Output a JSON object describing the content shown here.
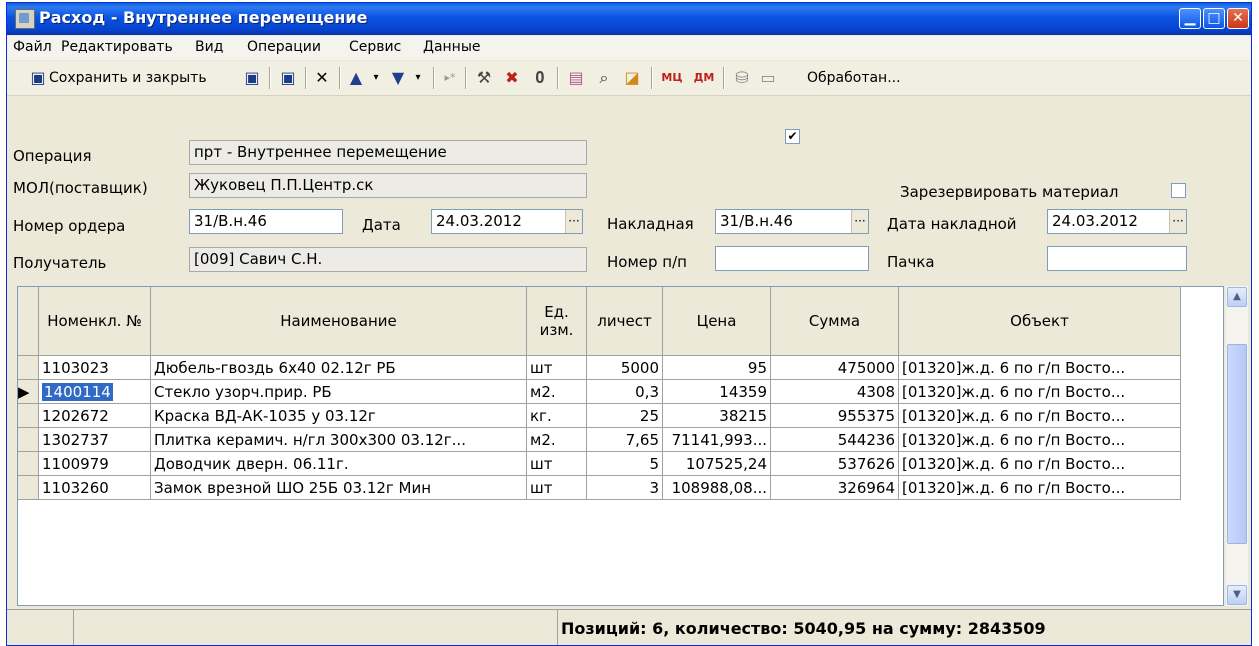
{
  "window": {
    "title": "Расход - Внутреннее перемещение"
  },
  "menu": [
    "Файл",
    "Редактировать",
    "Вид",
    "Операции",
    "Сервис",
    "Данные"
  ],
  "toolbar": {
    "save_close_label": "Сохранить и закрыть",
    "processed_label": "Обработан...",
    "processed_checked": true
  },
  "form": {
    "operation_label": "Операция",
    "operation_value": "прт - Внутреннее перемещение",
    "mol_label": "МОЛ(поставщик)",
    "mol_value": "Жуковец П.П.Центр.ск",
    "reserve_label": "Зарезервировать материал",
    "order_label": "Номер ордера",
    "order_value": "31/В.н.46",
    "date_label": "Дата",
    "date_value": "24.03.2012",
    "invoice_label": "Накладная",
    "invoice_value": "31/В.н.46",
    "invoice_date_label": "Дата накладной",
    "invoice_date_value": "24.03.2012",
    "recipient_label": "Получатель",
    "recipient_value": "[009] Савич С.Н.",
    "np_label": "Номер п/п",
    "np_value": "",
    "pack_label": "Пачка",
    "pack_value": ""
  },
  "table": {
    "headers": [
      "Номенкл. №",
      "Наименование",
      "Ед. изм.",
      "личест",
      "Цена",
      "Сумма",
      "Объект"
    ],
    "rows": [
      [
        "1103023",
        "Дюбель-гвоздь 6х40 02.12г РБ",
        "шт",
        "5000",
        "95",
        "475000",
        "[01320]ж.д. 6 по г/п Восто..."
      ],
      [
        "1400114",
        "Стекло узорч.прир. РБ",
        "м2.",
        "0,3",
        "14359",
        "4308",
        "[01320]ж.д. 6 по г/п Восто..."
      ],
      [
        "1202672",
        "Краска ВД-АК-1035 у 03.12г",
        "кг.",
        "25",
        "38215",
        "955375",
        "[01320]ж.д. 6 по г/п Восто..."
      ],
      [
        "1302737",
        "Плитка керамич. н/гл 300х300 03.12г...",
        "м2.",
        "7,65",
        "71141,993...",
        "544236",
        "[01320]ж.д. 6 по г/п Восто..."
      ],
      [
        "1100979",
        "Доводчик дверн. 06.11г.",
        "шт",
        "5",
        "107525,24",
        "537626",
        "[01320]ж.д. 6 по г/п Восто..."
      ],
      [
        "1103260",
        "Замок врезной ШО 25Б 03.12г Мин",
        "шт",
        "3",
        "108988,08...",
        "326964",
        "[01320]ж.д. 6 по г/п Восто..."
      ]
    ]
  },
  "status": {
    "summary": "Позиций: 6, количество: 5040,95 на сумму: 2843509"
  }
}
